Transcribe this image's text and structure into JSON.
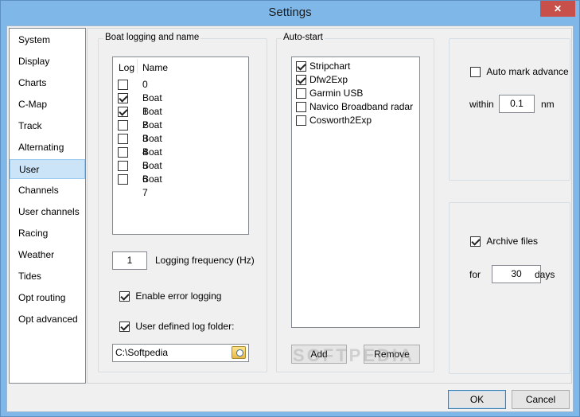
{
  "window": {
    "title": "Settings",
    "close_label": "✕"
  },
  "nav": {
    "items": [
      "System",
      "Display",
      "Charts",
      "C-Map",
      "Track",
      "Alternating",
      "User",
      "Channels",
      "User channels",
      "Racing",
      "Weather",
      "Tides",
      "Opt routing",
      "Opt advanced"
    ],
    "selected": "User"
  },
  "boat_logging": {
    "title": "Boat logging and name",
    "header_log": "Log",
    "header_name": "Name",
    "boats": [
      {
        "name": "0",
        "checked": false
      },
      {
        "name": "Boat 1",
        "checked": true
      },
      {
        "name": "Boat 2",
        "checked": true
      },
      {
        "name": "Boat 3",
        "checked": false
      },
      {
        "name": "Boat 4",
        "checked": false
      },
      {
        "name": "Boat 5",
        "checked": false
      },
      {
        "name": "Boat 6",
        "checked": false
      },
      {
        "name": "Boat 7",
        "checked": false
      }
    ],
    "frequency_value": "1",
    "frequency_label": "Logging frequency (Hz)",
    "enable_error_logging_label": "Enable error logging",
    "enable_error_logging_checked": true,
    "user_log_folder_label": "User defined log folder:",
    "user_log_folder_checked": true,
    "folder_value": "C:\\Softpedia"
  },
  "auto_start": {
    "title": "Auto-start",
    "items": [
      {
        "label": "Stripchart",
        "checked": true
      },
      {
        "label": "Dfw2Exp",
        "checked": true
      },
      {
        "label": "Garmin USB",
        "checked": false
      },
      {
        "label": "Navico Broadband radar",
        "checked": false
      },
      {
        "label": "Cosworth2Exp",
        "checked": false
      }
    ],
    "add_label": "Add",
    "remove_label": "Remove"
  },
  "auto_mark": {
    "label": "Auto mark advance",
    "checked": false,
    "within_label": "within",
    "within_value": "0.1",
    "unit": "nm"
  },
  "archive": {
    "label": "Archive files",
    "checked": true,
    "for_label": "for",
    "days_value": "30",
    "days_label": "days"
  },
  "footer": {
    "ok_label": "OK",
    "cancel_label": "Cancel"
  },
  "watermark": "SOFTPEDIA"
}
